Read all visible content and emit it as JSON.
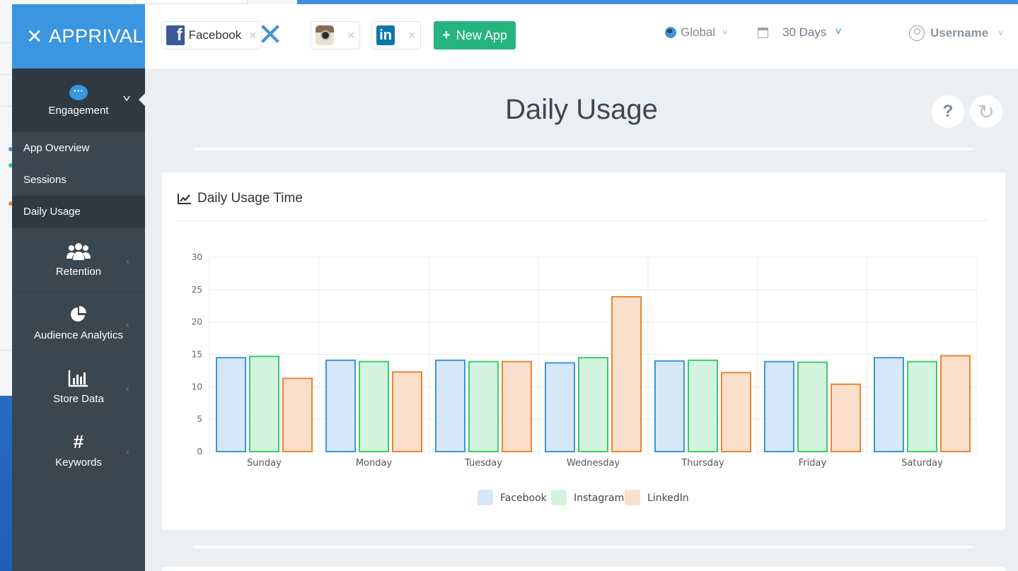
{
  "brand": {
    "name": "APPRIVAL"
  },
  "sidebar": {
    "engagement_label": "Engagement",
    "subitems": [
      {
        "label": "App Overview"
      },
      {
        "label": "Sessions"
      },
      {
        "label": "Daily Usage"
      }
    ],
    "items": [
      {
        "label": "Retention",
        "icon": "users-icon"
      },
      {
        "label": "Audience Analytics",
        "icon": "pie-chart-icon"
      },
      {
        "label": "Store Data",
        "icon": "bar-chart-icon"
      },
      {
        "label": "Keywords",
        "icon": "hashtag-icon"
      }
    ]
  },
  "header": {
    "apps": [
      {
        "name": "Facebook",
        "icon": "facebook-icon"
      },
      {
        "name": "",
        "icon": "instagram-icon"
      },
      {
        "name": "",
        "icon": "linkedin-icon"
      }
    ],
    "new_app_label": "New App",
    "region_label": "Global",
    "range_label": "30 Days",
    "user_label": "Username"
  },
  "main": {
    "page_title": "Daily Usage",
    "card_title": "Daily Usage Time"
  },
  "colors": {
    "facebook": "#3b95df",
    "instagram": "#3dcb6c",
    "linkedin": "#e8872f"
  },
  "chart_data": {
    "type": "bar",
    "categories": [
      "Sunday",
      "Monday",
      "Tuesday",
      "Wednesday",
      "Thursday",
      "Friday",
      "Saturday"
    ],
    "series": [
      {
        "name": "Facebook",
        "values": [
          14.6,
          14.2,
          14.2,
          13.8,
          14.1,
          14.0,
          14.6
        ]
      },
      {
        "name": "Instagram",
        "values": [
          14.8,
          14.0,
          14.0,
          14.6,
          14.2,
          13.9,
          14.0
        ]
      },
      {
        "name": "LinkedIn",
        "values": [
          11.4,
          12.4,
          14.0,
          24.0,
          12.3,
          10.5,
          14.9
        ]
      }
    ],
    "yticks": [
      0,
      5,
      10,
      15,
      20,
      25,
      30
    ],
    "ylim": [
      0,
      30
    ],
    "grid": true,
    "legend": "bottom"
  }
}
